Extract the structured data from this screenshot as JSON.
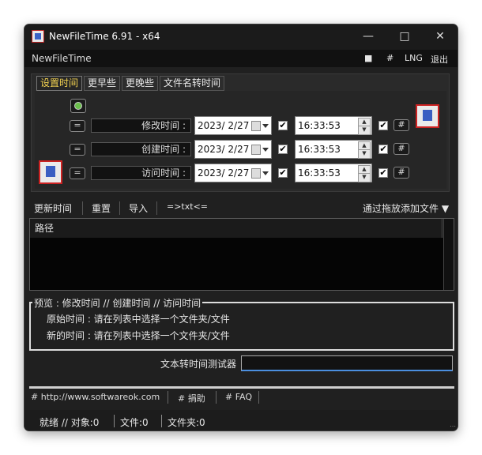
{
  "window": {
    "title": "NewFileTime 6.91 - x64"
  },
  "menu": {
    "app_label": "NewFileTime",
    "square": "■",
    "hash": "#",
    "lng": "LNG",
    "exit": "退出"
  },
  "tabs": [
    "设置时间",
    "更早些",
    "更晚些",
    "文件名转时间"
  ],
  "rows": [
    {
      "eq": "=",
      "label": "修改时间 :",
      "date": "2023/ 2/27",
      "time": "16:33:53",
      "hash": "#"
    },
    {
      "eq": "=",
      "label": "创建时间 :",
      "date": "2023/ 2/27",
      "time": "16:33:53",
      "hash": "#"
    },
    {
      "eq": "=",
      "label": "访问时间 :",
      "date": "2023/ 2/27",
      "time": "16:33:53",
      "hash": "#"
    }
  ],
  "toolbar": {
    "update": "更新时间",
    "reset": "重置",
    "import": "导入",
    "txt": "=>txt<=",
    "add_by_drag": "通过拖放添加文件 ▼"
  },
  "list": {
    "col_path": "路径"
  },
  "preview": {
    "legend": "预览 :   修改时间   //   创建时间   //   访问时间",
    "original": "原始时间 : 请在列表中选择一个文件夹/文件",
    "new": "新的时间 : 请在列表中选择一个文件夹/文件"
  },
  "tester": {
    "label": "文本转时间测试器",
    "value": ""
  },
  "links": {
    "site": "# http://www.softwareok.com",
    "donate": "# 捐助",
    "faq": "# FAQ"
  },
  "status": {
    "ready": "就绪 // 对象:0",
    "files": "文件:0",
    "folders": "文件夹:0"
  },
  "checkmark": "✔"
}
